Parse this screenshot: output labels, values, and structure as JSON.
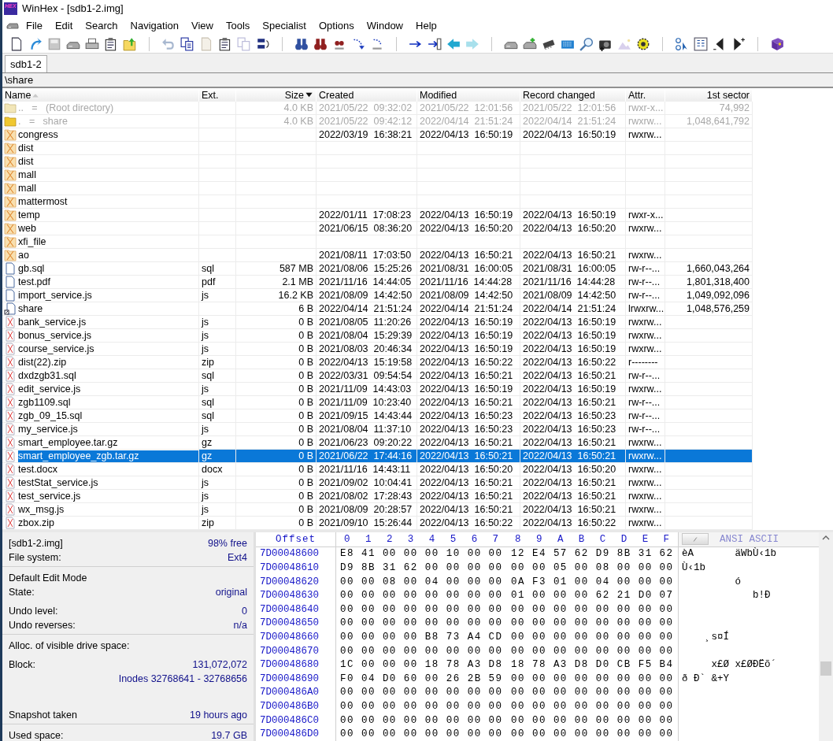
{
  "window": {
    "logo_text": "HEX",
    "title": "WinHex - [sdb1-2.img]"
  },
  "menu": [
    "File",
    "Edit",
    "Search",
    "Navigation",
    "View",
    "Tools",
    "Specialist",
    "Options",
    "Window",
    "Help"
  ],
  "tabs": [
    {
      "label": "sdb1-2",
      "selected": true
    }
  ],
  "path": "\\share",
  "table": {
    "columns": [
      {
        "label": "Name",
        "sorted": true,
        "descending": false
      },
      {
        "label": "Ext.",
        "sorted": false
      },
      {
        "label": "Size",
        "sorted": true,
        "descending": true
      },
      {
        "label": "Created",
        "sorted": false
      },
      {
        "label": "Modified",
        "sorted": false
      },
      {
        "label": "Record changed",
        "sorted": false
      },
      {
        "label": "Attr.",
        "sorted": false
      },
      {
        "label": "1st sector",
        "sorted": false
      }
    ],
    "rows": [
      {
        "kind": "parent",
        "name": "..   =   (Root directory)",
        "size": "4.0 KB",
        "created": "2021/05/22  09:32:02",
        "modified": "2021/05/22  12:01:56",
        "changed": "2021/05/22  12:01:56",
        "attr": "rwxr-x...",
        "sector": "74,992",
        "dim": true,
        "selected": false
      },
      {
        "kind": "folder",
        "name": ".   =   share",
        "size": "4.0 KB",
        "created": "2021/05/22  09:42:12",
        "modified": "2022/04/14  21:51:24",
        "changed": "2022/04/14  21:51:24",
        "attr": "rwxrw...",
        "sector": "1,048,641,792",
        "dim": true,
        "selected": false
      },
      {
        "kind": "deleted-folder",
        "name": "congress",
        "created": "2022/03/19  16:38:21",
        "modified": "2022/04/13  16:50:19",
        "changed": "2022/04/13  16:50:19",
        "attr": "rwxrw...",
        "dim": false,
        "selected": false
      },
      {
        "kind": "deleted-folder",
        "name": "dist",
        "dim": false,
        "selected": false
      },
      {
        "kind": "deleted-folder",
        "name": "dist",
        "dim": false,
        "selected": false
      },
      {
        "kind": "deleted-folder",
        "name": "mall",
        "dim": false,
        "selected": false
      },
      {
        "kind": "deleted-folder",
        "name": "mall",
        "dim": false,
        "selected": false
      },
      {
        "kind": "deleted-folder",
        "name": "mattermost",
        "dim": false,
        "selected": false
      },
      {
        "kind": "deleted-folder",
        "name": "temp",
        "created": "2022/01/11  17:08:23",
        "modified": "2022/04/13  16:50:19",
        "changed": "2022/04/13  16:50:19",
        "attr": "rwxr-x...",
        "dim": false,
        "selected": false
      },
      {
        "kind": "deleted-folder",
        "name": "web",
        "created": "2021/06/15  08:36:20",
        "modified": "2022/04/13  16:50:20",
        "changed": "2022/04/13  16:50:20",
        "attr": "rwxrw...",
        "dim": false,
        "selected": false
      },
      {
        "kind": "deleted-folder",
        "name": "xfi_file",
        "dim": false,
        "selected": false
      },
      {
        "kind": "deleted-folder",
        "name": "ao",
        "created": "2021/08/11  17:03:50",
        "modified": "2022/04/13  16:50:21",
        "changed": "2022/04/13  16:50:21",
        "attr": "rwxrw...",
        "dim": false,
        "selected": false
      },
      {
        "kind": "file",
        "name": "gb.sql",
        "ext": "sql",
        "size": "587 MB",
        "created": "2021/08/06  15:25:26",
        "modified": "2021/08/31  16:00:05",
        "changed": "2021/08/31  16:00:05",
        "attr": "rw-r--...",
        "sector": "1,660,043,264",
        "dim": false,
        "selected": false
      },
      {
        "kind": "file",
        "name": "test.pdf",
        "ext": "pdf",
        "size": "2.1 MB",
        "created": "2021/11/16  14:44:05",
        "modified": "2021/11/16  14:44:28",
        "changed": "2021/11/16  14:44:28",
        "attr": "rw-r--...",
        "sector": "1,801,318,400",
        "dim": false,
        "selected": false
      },
      {
        "kind": "file",
        "name": "import_service.js",
        "ext": "js",
        "size": "16.2 KB",
        "created": "2021/08/09  14:42:50",
        "modified": "2021/08/09  14:42:50",
        "changed": "2021/08/09  14:42:50",
        "attr": "rw-r--...",
        "sector": "1,049,092,096",
        "dim": false,
        "selected": false
      },
      {
        "kind": "link",
        "name": "share",
        "size": "6 B",
        "created": "2022/04/14  21:51:24",
        "modified": "2022/04/14  21:51:24",
        "changed": "2022/04/14  21:51:24",
        "attr": "lrwxrw...",
        "sector": "1,048,576,259",
        "dim": false,
        "selected": false
      },
      {
        "kind": "deleted-file",
        "name": "bank_service.js",
        "ext": "js",
        "size": "0 B",
        "created": "2021/08/05  11:20:26",
        "modified": "2022/04/13  16:50:19",
        "changed": "2022/04/13  16:50:19",
        "attr": "rwxrw...",
        "dim": false,
        "selected": false
      },
      {
        "kind": "deleted-file",
        "name": "bonus_service.js",
        "ext": "js",
        "size": "0 B",
        "created": "2021/08/04  15:29:39",
        "modified": "2022/04/13  16:50:19",
        "changed": "2022/04/13  16:50:19",
        "attr": "rwxrw...",
        "dim": false,
        "selected": false
      },
      {
        "kind": "deleted-file",
        "name": "course_service.js",
        "ext": "js",
        "size": "0 B",
        "created": "2021/08/03  20:46:34",
        "modified": "2022/04/13  16:50:19",
        "changed": "2022/04/13  16:50:19",
        "attr": "rwxrw...",
        "dim": false,
        "selected": false
      },
      {
        "kind": "deleted-file",
        "name": "dist(22).zip",
        "ext": "zip",
        "size": "0 B",
        "created": "2022/04/13  15:19:58",
        "modified": "2022/04/13  16:50:22",
        "changed": "2022/04/13  16:50:22",
        "attr": "r--------",
        "dim": false,
        "selected": false
      },
      {
        "kind": "deleted-file",
        "name": "dxdzgb31.sql",
        "ext": "sql",
        "size": "0 B",
        "created": "2022/03/31  09:54:54",
        "modified": "2022/04/13  16:50:21",
        "changed": "2022/04/13  16:50:21",
        "attr": "rw-r--...",
        "dim": false,
        "selected": false
      },
      {
        "kind": "deleted-file",
        "name": "edit_service.js",
        "ext": "js",
        "size": "0 B",
        "created": "2021/11/09  14:43:03",
        "modified": "2022/04/13  16:50:19",
        "changed": "2022/04/13  16:50:19",
        "attr": "rwxrw...",
        "dim": false,
        "selected": false
      },
      {
        "kind": "deleted-file",
        "name": "zgb1109.sql",
        "ext": "sql",
        "size": "0 B",
        "created": "2021/11/09  10:23:40",
        "modified": "2022/04/13  16:50:21",
        "changed": "2022/04/13  16:50:21",
        "attr": "rw-r--...",
        "dim": false,
        "selected": false
      },
      {
        "kind": "deleted-file",
        "name": "zgb_09_15.sql",
        "ext": "sql",
        "size": "0 B",
        "created": "2021/09/15  14:43:44",
        "modified": "2022/04/13  16:50:23",
        "changed": "2022/04/13  16:50:23",
        "attr": "rw-r--...",
        "dim": false,
        "selected": false
      },
      {
        "kind": "deleted-file",
        "name": "my_service.js",
        "ext": "js",
        "size": "0 B",
        "created": "2021/08/04  11:37:10",
        "modified": "2022/04/13  16:50:23",
        "changed": "2022/04/13  16:50:23",
        "attr": "rw-r--...",
        "dim": false,
        "selected": false
      },
      {
        "kind": "deleted-file",
        "name": "smart_employee.tar.gz",
        "ext": "gz",
        "size": "0 B",
        "created": "2021/06/23  09:20:22",
        "modified": "2022/04/13  16:50:21",
        "changed": "2022/04/13  16:50:21",
        "attr": "rwxrw...",
        "dim": false,
        "selected": false
      },
      {
        "kind": "deleted-file",
        "name": "smart_employee_zgb.tar.gz",
        "ext": "gz",
        "size": "0 B",
        "created": "2021/06/22  17:44:16",
        "modified": "2022/04/13  16:50:21",
        "changed": "2022/04/13  16:50:21",
        "attr": "rwxrw...",
        "dim": false,
        "selected": true
      },
      {
        "kind": "deleted-file",
        "name": "test.docx",
        "ext": "docx",
        "size": "0 B",
        "created": "2021/11/16  14:43:11",
        "modified": "2022/04/13  16:50:20",
        "changed": "2022/04/13  16:50:20",
        "attr": "rwxrw...",
        "dim": false,
        "selected": false
      },
      {
        "kind": "deleted-file",
        "name": "testStat_service.js",
        "ext": "js",
        "size": "0 B",
        "created": "2021/09/02  10:04:41",
        "modified": "2022/04/13  16:50:21",
        "changed": "2022/04/13  16:50:21",
        "attr": "rwxrw...",
        "dim": false,
        "selected": false
      },
      {
        "kind": "deleted-file",
        "name": "test_service.js",
        "ext": "js",
        "size": "0 B",
        "created": "2021/08/02  17:28:43",
        "modified": "2022/04/13  16:50:21",
        "changed": "2022/04/13  16:50:21",
        "attr": "rwxrw...",
        "dim": false,
        "selected": false
      },
      {
        "kind": "deleted-file",
        "name": "wx_msg.js",
        "ext": "js",
        "size": "0 B",
        "created": "2021/08/09  20:28:57",
        "modified": "2022/04/13  16:50:21",
        "changed": "2022/04/13  16:50:21",
        "attr": "rwxrw...",
        "dim": false,
        "selected": false
      },
      {
        "kind": "deleted-file",
        "name": "zbox.zip",
        "ext": "zip",
        "size": "0 B",
        "created": "2021/09/10  15:26:44",
        "modified": "2022/04/13  16:50:22",
        "changed": "2022/04/13  16:50:22",
        "attr": "rwxrw...",
        "dim": false,
        "selected": false
      }
    ]
  },
  "info_panel": {
    "sections": [
      {
        "groups": [
          [
            {
              "label": "[sdb1-2.img]",
              "value": "98% free"
            },
            {
              "label": "File system:",
              "value": "Ext4"
            }
          ]
        ]
      },
      {
        "groups": [
          [
            {
              "label": "Default Edit Mode"
            },
            {
              "label": "State:",
              "value": "original"
            }
          ],
          [
            {
              "label": "Undo level:",
              "value": "0"
            },
            {
              "label": "Undo reverses:",
              "value": "n/a"
            }
          ]
        ]
      },
      {
        "groups": [
          [
            {
              "label": "Alloc. of visible drive space:"
            }
          ],
          [
            {
              "label": "Block:",
              "value": "131,072,072"
            },
            {
              "value": "Inodes 32768641 - 32768656"
            }
          ],
          [
            {
              "label": "Snapshot taken",
              "value": "19 hours ago"
            }
          ]
        ]
      },
      {
        "groups": [
          [
            {
              "label": "Used space:",
              "value": "19.7 GB"
            }
          ]
        ]
      }
    ]
  },
  "hex": {
    "offset_label": "Offset",
    "header_left": "0  1  2  3  4  5  6  7",
    "header_right": "8  9  A  B  C  D  E  F",
    "text_label": "ANSI ASCII",
    "rows": [
      {
        "offset": "7D00048600",
        "left": "E8 41 00 00 00 10 00 00",
        "right": "12 E4 57 62 D9 8B 31 62",
        "text": "èA       äWbÙ‹1b"
      },
      {
        "offset": "7D00048610",
        "left": "D9 8B 31 62 00 00 00 00",
        "right": "00 00 05 00 08 00 00 00",
        "text": "Ù‹1b"
      },
      {
        "offset": "7D00048620",
        "left": "00 00 08 00 04 00 00 00",
        "right": "0A F3 01 00 04 00 00 00",
        "text": "         ó"
      },
      {
        "offset": "7D00048630",
        "left": "00 00 00 00 00 00 00 00",
        "right": "01 00 00 00 62 21 D0 07",
        "text": "            b!Ð"
      },
      {
        "offset": "7D00048640",
        "left": "00 00 00 00 00 00 00 00",
        "right": "00 00 00 00 00 00 00 00"
      },
      {
        "offset": "7D00048650",
        "left": "00 00 00 00 00 00 00 00",
        "right": "00 00 00 00 00 00 00 00"
      },
      {
        "offset": "7D00048660",
        "left": "00 00 00 00 B8 73 A4 CD",
        "right": "00 00 00 00 00 00 00 00",
        "text": "    ¸s¤Í"
      },
      {
        "offset": "7D00048670",
        "left": "00 00 00 00 00 00 00 00",
        "right": "00 00 00 00 00 00 00 00"
      },
      {
        "offset": "7D00048680",
        "left": "1C 00 00 00 18 78 A3 D8",
        "right": "18 78 A3 D8 D0 CB F5 B4",
        "text": "     x£Ø x£ØÐËõ´"
      },
      {
        "offset": "7D00048690",
        "left": "F0 04 D0 60 00 26 2B 59",
        "right": "00 00 00 00 00 00 00 00",
        "text": "ð Ð` &+Y"
      },
      {
        "offset": "7D000486A0",
        "left": "00 00 00 00 00 00 00 00",
        "right": "00 00 00 00 00 00 00 00"
      },
      {
        "offset": "7D000486B0",
        "left": "00 00 00 00 00 00 00 00",
        "right": "00 00 00 00 00 00 00 00"
      },
      {
        "offset": "7D000486C0",
        "left": "00 00 00 00 00 00 00 00",
        "right": "00 00 00 00 00 00 00 00"
      },
      {
        "offset": "7D000486D0",
        "left": "00 00 00 00 00 00 00 00",
        "right": "00 00 00 00 00 00 00 00"
      }
    ]
  }
}
